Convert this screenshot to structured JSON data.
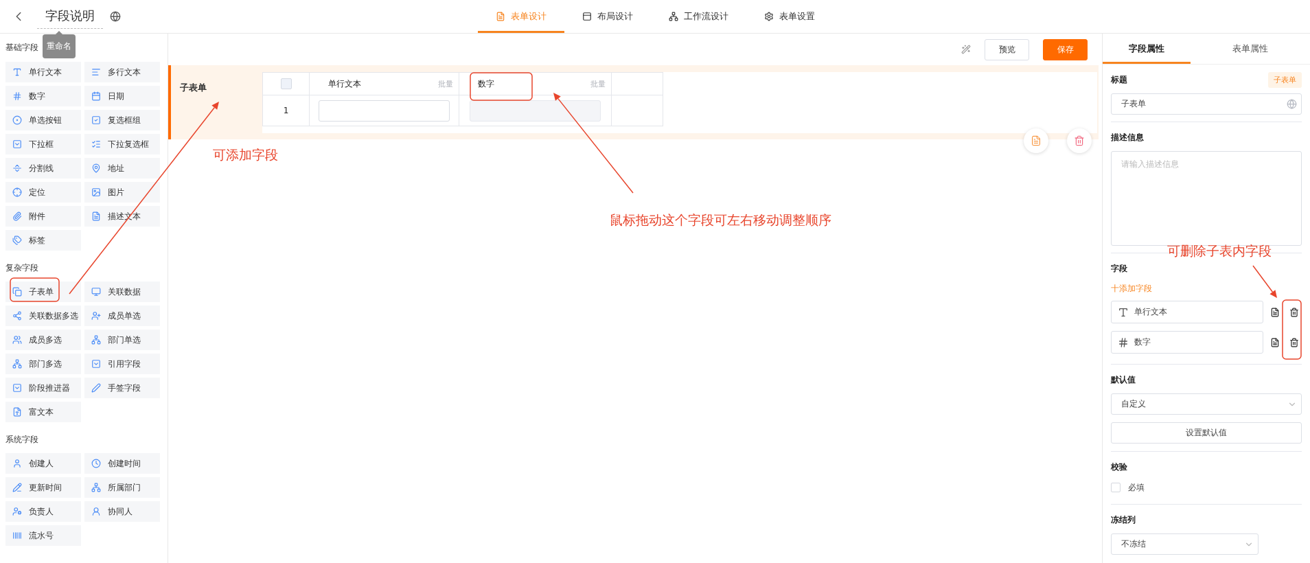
{
  "header": {
    "title": "字段说明",
    "tooltip": "重命名",
    "tabs": [
      {
        "label": "表单设计",
        "selected": true
      },
      {
        "label": "布局设计",
        "selected": false
      },
      {
        "label": "工作流设计",
        "selected": false
      },
      {
        "label": "表单设置",
        "selected": false
      }
    ]
  },
  "sidebar": {
    "sections": [
      {
        "title": "基础字段",
        "items": [
          "单行文本",
          "多行文本",
          "数字",
          "日期",
          "单选按钮",
          "复选框组",
          "下拉框",
          "下拉复选框",
          "分割线",
          "地址",
          "定位",
          "图片",
          "附件",
          "描述文本",
          "标签"
        ]
      },
      {
        "title": "复杂字段",
        "items": [
          "子表单",
          "关联数据",
          "关联数据多选",
          "成员单选",
          "成员多选",
          "部门单选",
          "部门多选",
          "引用字段",
          "阶段推进器",
          "手签字段",
          "富文本"
        ]
      },
      {
        "title": "系统字段",
        "items": [
          "创建人",
          "创建时间",
          "更新时间",
          "所属部门",
          "负责人",
          "协同人",
          "流水号"
        ]
      }
    ]
  },
  "toolbar": {
    "preview": "预览",
    "save": "保存"
  },
  "subform": {
    "label": "子表单",
    "select_all": {
      "checked": false
    },
    "columns": [
      {
        "title": "单行文本",
        "batch": "批量",
        "disabled": false
      },
      {
        "title": "数字",
        "batch": "批量",
        "disabled": true
      }
    ],
    "rows": [
      {
        "index": "1"
      }
    ]
  },
  "annotations": [
    "可添加字段",
    "鼠标拖动这个字段可左右移动调整顺序",
    "可删除子表内字段"
  ],
  "panel": {
    "tabs": [
      {
        "label": "字段属性",
        "selected": true
      },
      {
        "label": "表单属性",
        "selected": false
      }
    ],
    "title_label": "标题",
    "title_badge": "子表单",
    "title_value": "子表单",
    "desc_label": "描述信息",
    "desc_placeholder": "请输入描述信息",
    "fields_label": "字段",
    "add_field": "十添加字段",
    "fields": [
      "单行文本",
      "数字"
    ],
    "default_label": "默认值",
    "default_select": "自定义",
    "default_button": "设置默认值",
    "validation_label": "校验",
    "required": {
      "label": "必填",
      "checked": false
    },
    "freeze_label": "冻结列",
    "freeze_select": "不冻结"
  }
}
